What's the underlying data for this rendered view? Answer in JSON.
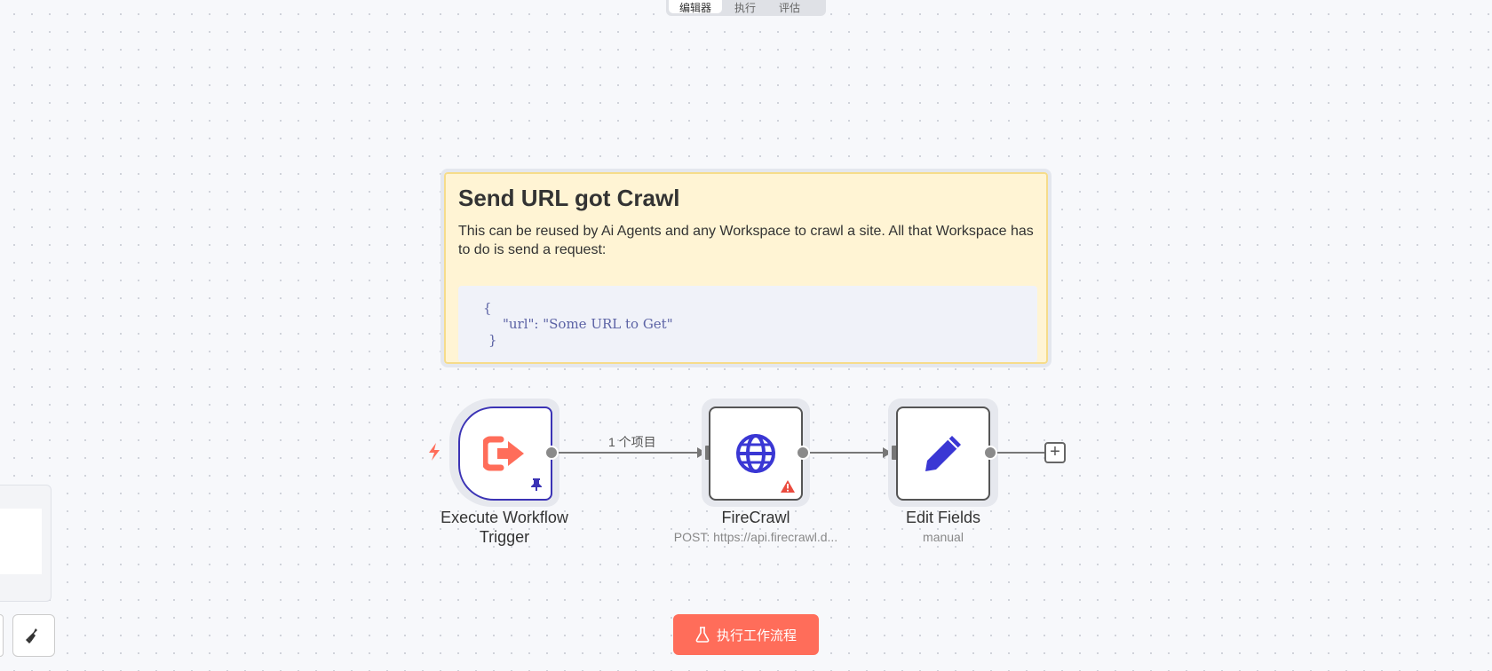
{
  "tabs": [
    {
      "label": "编辑器"
    },
    {
      "label": "执行"
    },
    {
      "label": "评估"
    }
  ],
  "sticky_note": {
    "title": "Send URL got Crawl",
    "body": "This can be reused by Ai Agents and any Workspace to crawl a site. All that Workspace has to do is send a request:",
    "code_lines": [
      "{",
      "\"url\": \"Some URL to Get\"",
      "}"
    ]
  },
  "nodes": [
    {
      "title": "Execute Workflow Trigger",
      "subtitle": "",
      "icon": "sign-out-icon"
    },
    {
      "title": "FireCrawl",
      "subtitle": "POST: https://api.firecrawl.d...",
      "icon": "globe-icon"
    },
    {
      "title": "Edit Fields",
      "subtitle": "manual",
      "icon": "pencil-icon"
    }
  ],
  "connections": [
    {
      "label": "1 个项目"
    }
  ],
  "execute_button": {
    "label": "执行工作流程"
  },
  "colors": {
    "accent": "#ff6d5a",
    "trigger_border": "#3b33b5",
    "icon_blue": "#3a37d4",
    "sticky_bg": "#fff4d4"
  }
}
